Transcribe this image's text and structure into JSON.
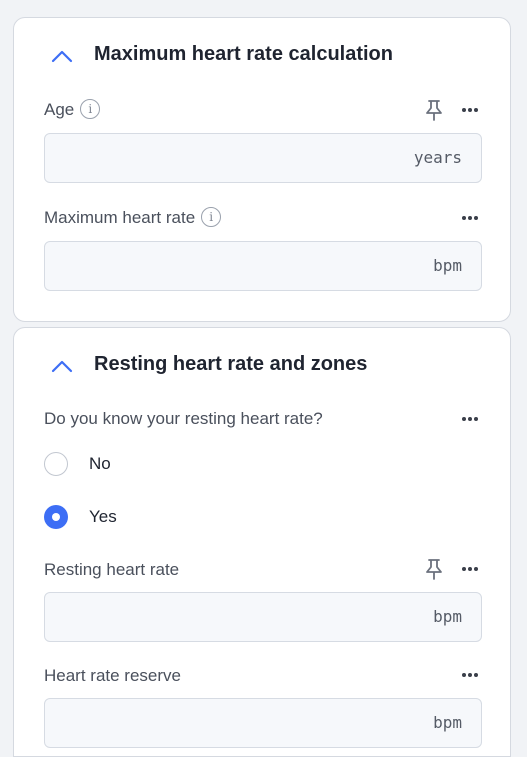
{
  "colors": {
    "accent": "#3d6ef5",
    "card_border": "#d5d9e0",
    "input_bg": "#f6f8fb"
  },
  "sections": [
    {
      "title": "Maximum heart rate calculation",
      "toggle_icon": "chevron-up-icon",
      "fields": [
        {
          "label": "Age",
          "has_info": true,
          "has_pin": true,
          "value": "",
          "unit": "years"
        },
        {
          "label": "Maximum heart rate",
          "has_info": true,
          "has_pin": false,
          "value": "",
          "unit": "bpm"
        }
      ]
    },
    {
      "title": "Resting heart rate and zones",
      "toggle_icon": "chevron-up-icon",
      "question": {
        "label": "Do you know your resting heart rate?",
        "options": [
          {
            "label": "No",
            "selected": false
          },
          {
            "label": "Yes",
            "selected": true
          }
        ]
      },
      "fields": [
        {
          "label": "Resting heart rate",
          "has_info": false,
          "has_pin": true,
          "value": "",
          "unit": "bpm"
        },
        {
          "label": "Heart rate reserve",
          "has_info": false,
          "has_pin": false,
          "value": "",
          "unit": "bpm"
        }
      ]
    }
  ]
}
